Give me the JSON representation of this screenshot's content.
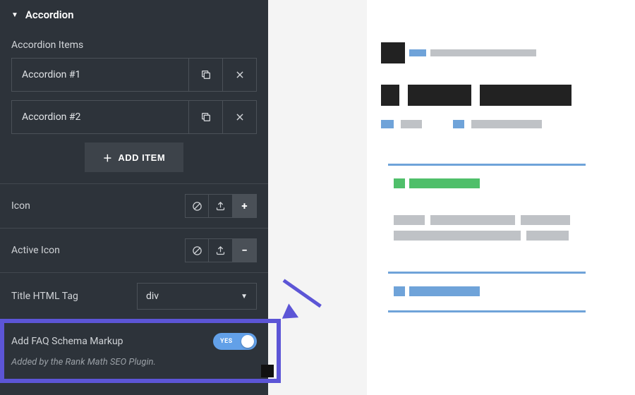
{
  "section": {
    "title": "Accordion"
  },
  "items_label": "Accordion Items",
  "items": [
    {
      "title": "Accordion #1"
    },
    {
      "title": "Accordion #2"
    }
  ],
  "add_item_label": "ADD ITEM",
  "icon": {
    "label": "Icon",
    "selected": "plus"
  },
  "active_icon": {
    "label": "Active Icon",
    "selected": "minus"
  },
  "title_tag": {
    "label": "Title HTML Tag",
    "value": "div"
  },
  "faq": {
    "label": "Add FAQ Schema Markup",
    "toggle_value": "YES",
    "caption": "Added by the Rank Math SEO Plugin."
  },
  "highlight_color": "#5c55d6",
  "toggle_color": "#62a0e8"
}
